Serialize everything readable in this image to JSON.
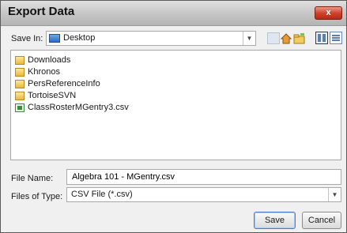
{
  "window": {
    "title": "Export Data",
    "close_label": "x"
  },
  "save_in": {
    "label": "Save In:",
    "value": "Desktop"
  },
  "toolbar": {
    "icons": [
      "up-folder-icon",
      "home-icon",
      "new-folder-icon",
      "list-view-icon",
      "details-view-icon"
    ]
  },
  "files": [
    {
      "name": "Downloads",
      "type": "folder"
    },
    {
      "name": "Khronos",
      "type": "folder"
    },
    {
      "name": "PersReferenceInfo",
      "type": "folder"
    },
    {
      "name": "TortoiseSVN",
      "type": "folder"
    },
    {
      "name": "ClassRosterMGentry3.csv",
      "type": "csv"
    }
  ],
  "file_name": {
    "label": "File Name:",
    "value": "Algebra 101 - MGentry.csv"
  },
  "files_of_type": {
    "label": "Files of Type:",
    "value": "CSV File (*.csv)"
  },
  "buttons": {
    "save": "Save",
    "cancel": "Cancel"
  },
  "colors": {
    "close_button": "#d0442e",
    "default_button_border": "#4d7fc4"
  }
}
